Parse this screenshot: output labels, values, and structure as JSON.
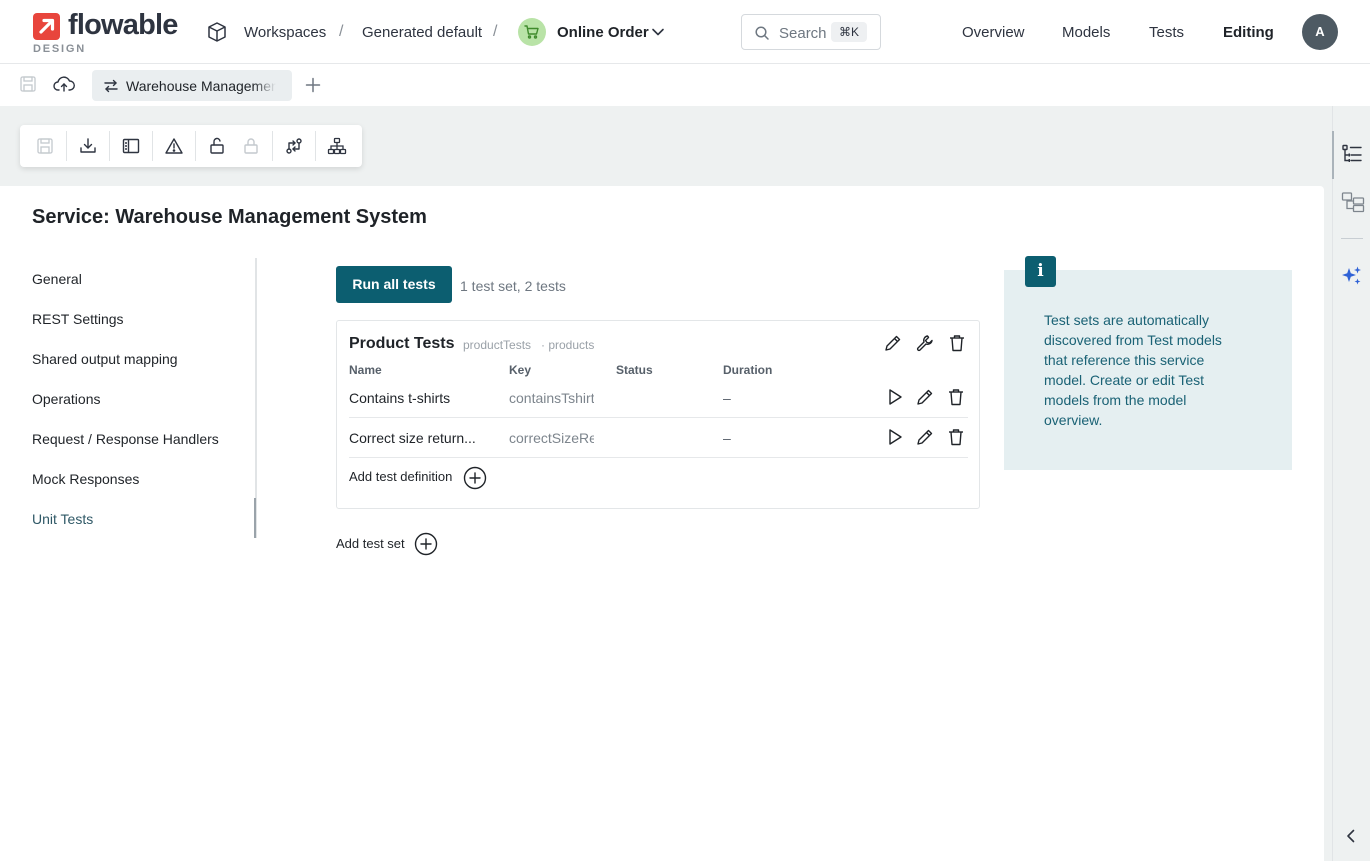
{
  "brand": {
    "name": "flowable",
    "sub": "DESIGN"
  },
  "breadcrumb": {
    "workspaces": "Workspaces",
    "workspace": "Generated default",
    "sep": "/",
    "app": "Online Order"
  },
  "search": {
    "placeholder": "Search",
    "shortcut": "⌘K"
  },
  "nav": {
    "overview": "Overview",
    "models": "Models",
    "tests": "Tests",
    "editing": "Editing"
  },
  "user": {
    "initial": "A"
  },
  "tab": {
    "label": "Warehouse Management System"
  },
  "page": {
    "title": "Service: Warehouse Management System"
  },
  "side_nav": [
    {
      "label": "General"
    },
    {
      "label": "REST Settings"
    },
    {
      "label": "Shared output mapping"
    },
    {
      "label": "Operations"
    },
    {
      "label": "Request / Response Handlers"
    },
    {
      "label": "Mock Responses"
    },
    {
      "label": "Unit Tests",
      "active": true
    }
  ],
  "tests": {
    "run_all_label": "Run all tests",
    "summary": "1 test set, 2 tests",
    "set": {
      "title": "Product Tests",
      "key": "productTests",
      "operation": "· products",
      "columns": {
        "name": "Name",
        "key": "Key",
        "status": "Status",
        "duration": "Duration"
      },
      "rows": [
        {
          "name": "Contains t-shirts",
          "key": "containsTshirts",
          "status": "",
          "duration": "–"
        },
        {
          "name": "Correct size return...",
          "key": "correctSizeReturned",
          "status": "",
          "duration": "–"
        }
      ],
      "add_definition_label": "Add test definition"
    },
    "add_set_label": "Add test set"
  },
  "info": {
    "badge": "i",
    "text": "Test sets are automatically discovered from Test models that reference this service model. Create or edit Test models from the model overview."
  },
  "colors": {
    "brand": "#e8453c",
    "primary": "#0c5e70",
    "info_bg": "#e5eff1",
    "info_text": "#1a6275",
    "app_badge": "#b9e3a7",
    "ai": "#2f62d6"
  },
  "icons": {
    "toolbar": [
      "save-icon",
      "download-icon",
      "panel-icon",
      "warning-icon",
      "unlock-icon",
      "lock-icon",
      "compare-icon",
      "hierarchy-icon"
    ],
    "rail": [
      "tree-list-icon",
      "structure-icon",
      "ai-sparkle-icon",
      "collapse-chevron-icon"
    ]
  }
}
